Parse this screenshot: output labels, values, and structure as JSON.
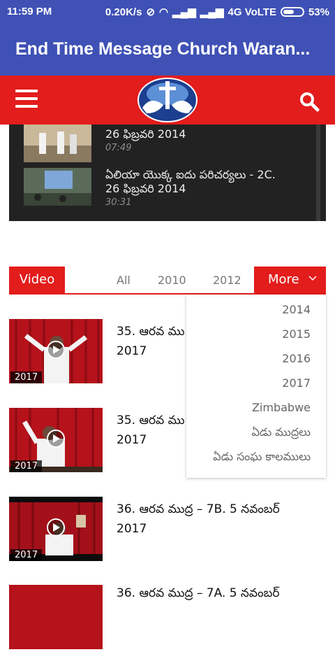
{
  "status_bar": {
    "time": "11:59 PM",
    "net_speed": "0.20K/s",
    "network": "4G VoLTE",
    "battery": "53%"
  },
  "app": {
    "title": "End Time Message Church Waran..."
  },
  "header": {
    "menu_icon": "hamburger-menu-icon",
    "logo": "church-logo-doves-cross",
    "search_icon": "search-icon"
  },
  "top_videos": [
    {
      "title_line1": "",
      "title_line2": "26 ఫిబ్రవరి 2014",
      "duration": "07:49"
    },
    {
      "title_line1": "ఏలియా యొక్క ఐదు పరిచర్యలు - 2C.",
      "title_line2": "26 ఫిబ్రవరి 2014",
      "duration": "30:31"
    }
  ],
  "tabs": {
    "video": "Video",
    "all": "All",
    "y2010": "2010",
    "y2012": "2012",
    "more": "More"
  },
  "dropdown": [
    "2014",
    "2015",
    "2016",
    "2017",
    "Zimbabwe",
    "ఏడు ముద్రలు",
    "ఏడు సంఘ కాలములు"
  ],
  "videos": [
    {
      "title_line1": "35. ఆరవ ము",
      "title_line2": "2017",
      "year": "2017"
    },
    {
      "title_line1": "35. ఆరవ ము",
      "title_line2": "2017",
      "year": "2017"
    },
    {
      "title_line1": "36. ఆరవ ముద్ర – 7B. 5 నవంబర్",
      "title_line2": "2017",
      "year": "2017"
    },
    {
      "title_line1": "36. ఆరవ ముద్ర – 7A. 5 నవంబర్",
      "title_line2": "",
      "year": ""
    }
  ],
  "colors": {
    "primary": "#3f51b5",
    "accent": "#e31c1c",
    "panel": "#222222"
  }
}
